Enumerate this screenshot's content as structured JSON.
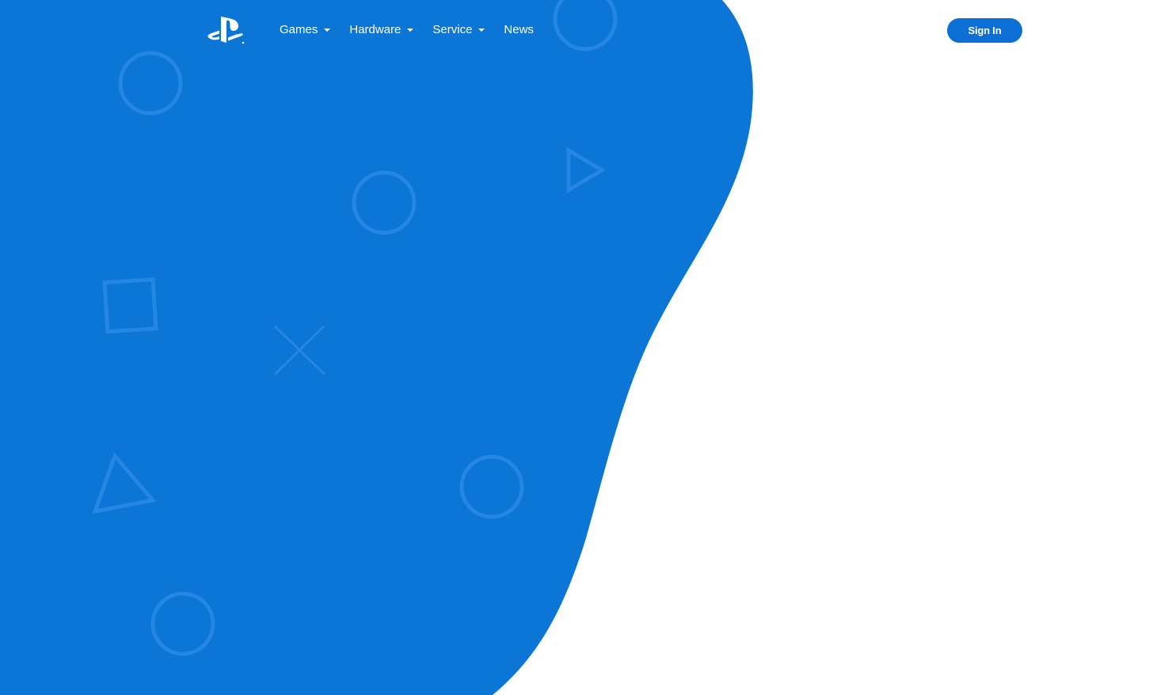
{
  "brand": {
    "logo_icon": "playstation-logo-icon",
    "primary_color": "#0b76d6",
    "shape_color": "#2a89e6",
    "button_color": "#0c6fd6",
    "text_color": "#ffffff"
  },
  "nav": {
    "items": [
      {
        "label": "Games",
        "has_dropdown": true
      },
      {
        "label": "Hardware",
        "has_dropdown": true
      },
      {
        "label": "Service",
        "has_dropdown": true
      },
      {
        "label": "News",
        "has_dropdown": false
      }
    ]
  },
  "auth": {
    "signin_label": "Sign In"
  },
  "decorations": {
    "icons": [
      "circle-icon",
      "triangle-icon",
      "square-icon",
      "cross-icon"
    ]
  }
}
